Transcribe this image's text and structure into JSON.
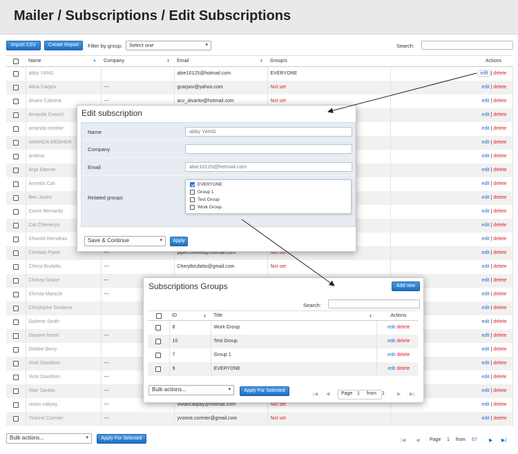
{
  "header": {
    "title": "Mailer / Subscriptions / Edit Subscriptions"
  },
  "toolbar": {
    "import_csv": "Import CSV",
    "create_report": "Create Report",
    "filter_label": "Filter by group:",
    "filter_value": "Select one",
    "search_label": "Search:"
  },
  "grid": {
    "headers": {
      "name": "Name",
      "company": "Company",
      "email": "Email",
      "groups": "Group/s",
      "actions": "Actions"
    },
    "rows": [
      {
        "name": "abby YANG",
        "company": "",
        "email": "abie10125@hotmail.com",
        "group": "EVERYONE"
      },
      {
        "name": "Alina Carpov",
        "company": "---",
        "email": "gcarpov@yahoo.com",
        "group": "Not set"
      },
      {
        "name": "Alvaro Cabrera",
        "company": "---",
        "email": "acv_alvarito@hotmail.com",
        "group": "Not set"
      },
      {
        "name": "Amanda Crouch",
        "company": "",
        "email": "",
        "group": ""
      },
      {
        "name": "amanda mosher",
        "company": "",
        "email": "",
        "group": ""
      },
      {
        "name": "AMANDA MOSHER",
        "company": "",
        "email": "",
        "group": ""
      },
      {
        "name": "Andrea",
        "company": "",
        "email": "",
        "group": ""
      },
      {
        "name": "Anja Daener",
        "company": "",
        "email": "",
        "group": ""
      },
      {
        "name": "Annetta Cali",
        "company": "",
        "email": "",
        "group": ""
      },
      {
        "name": "Ben Jones",
        "company": "",
        "email": "",
        "group": ""
      },
      {
        "name": "Carrie Bernardo",
        "company": "",
        "email": "",
        "group": ""
      },
      {
        "name": "Cat Chemerys",
        "company": "",
        "email": "",
        "group": ""
      },
      {
        "name": "Chantal Riendeau",
        "company": "",
        "email": "",
        "group": ""
      },
      {
        "name": "Chelsea Pyper",
        "company": "---",
        "email": "pipercheisea@hotmail.com",
        "group": "Not set"
      },
      {
        "name": "Cheryl Brufatto",
        "company": "---",
        "email": "Cherylbrufatto@gmail.com",
        "group": "Not set"
      },
      {
        "name": "Chrissy Grace",
        "company": "---",
        "email": "",
        "group": ""
      },
      {
        "name": "Christa Maracle",
        "company": "---",
        "email": "",
        "group": ""
      },
      {
        "name": "Christophe Smolens",
        "company": "",
        "email": "",
        "group": ""
      },
      {
        "name": "Darlene Smith",
        "company": "",
        "email": "",
        "group": ""
      },
      {
        "name": "Dayane fornel",
        "company": "---",
        "email": "",
        "group": ""
      },
      {
        "name": "Debbie Berry",
        "company": "",
        "email": "",
        "group": ""
      },
      {
        "name": "Vicki Davidson",
        "company": "---",
        "email": "",
        "group": ""
      },
      {
        "name": "Vicki Davidson",
        "company": "---",
        "email": "",
        "group": ""
      },
      {
        "name": "Vitor Santos",
        "company": "---",
        "email": "",
        "group": ""
      },
      {
        "name": "vivian calipay",
        "company": "---",
        "email": "viviancalipay@hotmail.com",
        "group": "Not set"
      },
      {
        "name": "Yvonne Cormier",
        "company": "---",
        "email": "yvonne.cormier@gmail.com",
        "group": "Not set"
      }
    ],
    "edit_label": "edit",
    "sep": "|",
    "delete_label": "delete"
  },
  "footer": {
    "bulk_label": "Bulk actions...",
    "apply_label": "Apply For Selected",
    "page_label": "Page",
    "page_num": "1",
    "from_label": "from",
    "total_pages": "67"
  },
  "edit_panel": {
    "title": "Edit subscription",
    "name_label": "Name",
    "name_value": "abby YANG",
    "company_label": "Company",
    "company_value": "",
    "email_label": "Email",
    "email_value": "abie10125@hetmail.com",
    "groups_label": "Related groups",
    "groups": [
      {
        "label": "EVERYONE",
        "checked": true
      },
      {
        "label": "Group 1",
        "checked": false
      },
      {
        "label": "Test Group",
        "checked": false
      },
      {
        "label": "Work Group",
        "checked": false
      }
    ],
    "save_select": "Save & Continue",
    "apply_label": "Apply"
  },
  "groups_panel": {
    "title": "Subscriptions Groups",
    "add_new": "Add new",
    "search_label": "Search:",
    "headers": {
      "id": "ID",
      "title": "Title",
      "actions": "Actions"
    },
    "rows": [
      {
        "id": "8",
        "title": "Work Group"
      },
      {
        "id": "10",
        "title": "Test Group"
      },
      {
        "id": "7",
        "title": "Group 1"
      },
      {
        "id": "9",
        "title": "EVERYONE"
      }
    ],
    "edit_label": "edit",
    "delete_label": "delete",
    "bulk_label": "Bulk actions...",
    "apply_label": "Apply For Selected",
    "page_label": "Page",
    "page_num": "1",
    "from_label": "from",
    "total_pages": "1"
  },
  "colors": {
    "accent": "#1f6fc4",
    "danger": "#e0202a"
  }
}
